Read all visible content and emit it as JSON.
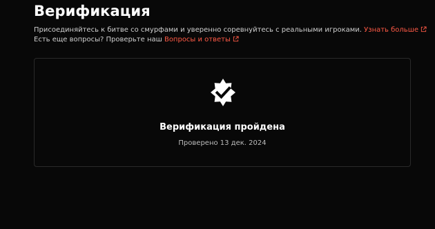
{
  "header": {
    "title": "Верификация"
  },
  "description": {
    "line1_text": "Присоединяйтесь к битве со смурфами и уверенно соревнуйтесь с реальными игроками.",
    "line1_link": "Узнать больше",
    "line2_text": "Есть еще вопросы? Проверьте наш",
    "line2_link": "Вопросы и ответы"
  },
  "status_card": {
    "icon": "verified-badge-icon",
    "title": "Верификация пройдена",
    "subtitle": "Проверено 13 дек. 2024"
  },
  "colors": {
    "background": "#080808",
    "accent_link": "#ff5a46",
    "card_border": "#2a2a2a"
  }
}
